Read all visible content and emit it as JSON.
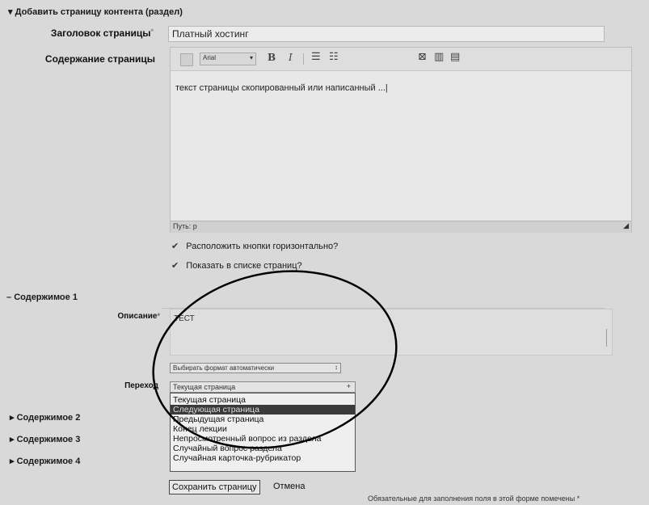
{
  "sections": {
    "add_page": {
      "toggle": "▾",
      "title": "Добавить страницу контента (раздел)"
    },
    "content1": {
      "toggle": "–",
      "title": "Содержимое 1"
    },
    "content2": {
      "toggle": "▸",
      "title": "Содержимое 2"
    },
    "content3": {
      "toggle": "▸",
      "title": "Содержимое 3"
    },
    "content4": {
      "toggle": "▸",
      "title": "Содержимое 4"
    }
  },
  "page_title": {
    "label": "Заголовок страницы",
    "required_mark": "*",
    "value": "Платный хостинг"
  },
  "page_content": {
    "label": "Содержание страницы",
    "font_select": "Arial",
    "bold": "B",
    "italic": "I",
    "body_text": "текст страницы    скопированный или написанный ...|",
    "path_label": "Путь: p"
  },
  "checkboxes": [
    {
      "label": "Расположить кнопки горизонтально?",
      "checked": true
    },
    {
      "label": "Показать в списке страниц?",
      "checked": true
    }
  ],
  "content1": {
    "description_label": "Описание",
    "required_mark": "*",
    "description_value": "ТЕСТ",
    "format_select": "Выбирать формат автоматически",
    "jump_label": "Переход",
    "jump_value": "Текущая страница",
    "jump_options": [
      "Текущая страница",
      "Следующая страница",
      "Предыдущая страница",
      "Конец лекции",
      "Непросмотренный вопрос из раздела",
      "Случайный вопрос раздела",
      "Случайная карточка-рубрикатор"
    ],
    "selected_option_index": 1
  },
  "buttons": {
    "save": "Сохранить страницу",
    "cancel": "Отмена"
  },
  "footer": {
    "required_note": "Обязательные для заполнения поля в этой форме помечены",
    "required_mark": "*"
  },
  "colors": {
    "background": "#d9d9d9",
    "selected_option_bg": "#3a3a3a",
    "annotation_ellipse": "#000000"
  }
}
